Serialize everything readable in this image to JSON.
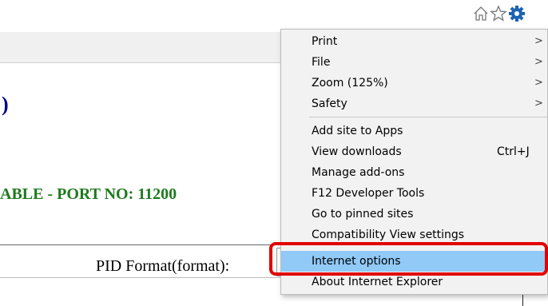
{
  "toolbar": {
    "icons": [
      "home-icon",
      "star-icon",
      "gear-icon"
    ],
    "accent_color": "#1a64b4"
  },
  "page": {
    "heading_partial": ")",
    "status_text": "ABLE - PORT NO: 11200",
    "pid_format_label": "PID Format(format):"
  },
  "menu": {
    "items": [
      {
        "label": "Print",
        "submenu": true
      },
      {
        "label": "File",
        "submenu": true
      },
      {
        "label": "Zoom (125%)",
        "submenu": true
      },
      {
        "label": "Safety",
        "submenu": true
      },
      {
        "label": "Add site to Apps"
      },
      {
        "label": "View downloads",
        "shortcut": "Ctrl+J"
      },
      {
        "label": "Manage add-ons"
      },
      {
        "label": "F12 Developer Tools"
      },
      {
        "label": "Go to pinned sites"
      },
      {
        "label": "Compatibility View settings"
      },
      {
        "label": "Internet options",
        "selected": true
      },
      {
        "label": "About Internet Explorer"
      }
    ],
    "submenu_arrow": ">",
    "selected_color": "#91c9f7",
    "highlight_color": "#e10000"
  }
}
